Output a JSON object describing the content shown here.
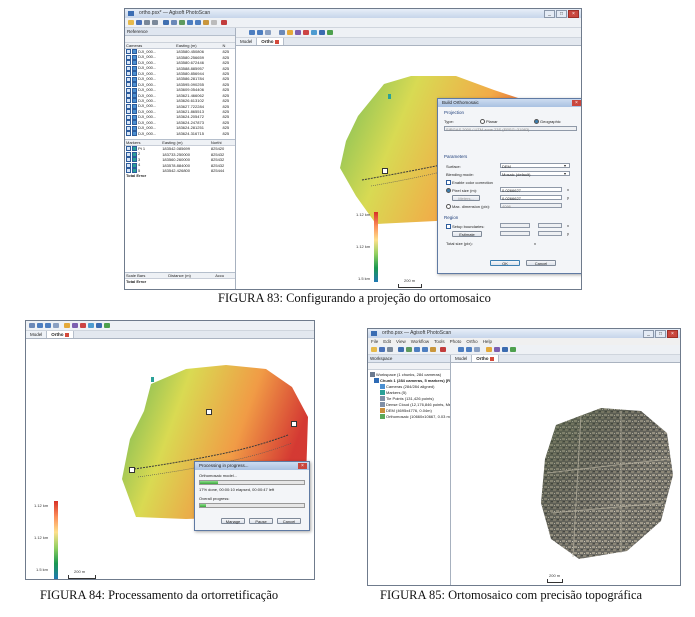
{
  "captions": {
    "fig83": "FIGURA 83: Configurando a projeção do ortomosaico",
    "fig84": "FIGURA 84: Processamento da ortorretificação",
    "fig85": "FIGURA 85: Ortomosaico com precisão topográfica"
  },
  "fig83": {
    "window_title": "ortho.psx* — Agisoft PhotoScan",
    "reference_panel_title": "Reference",
    "cameras_headers": [
      "Cameras",
      "Easting (m)",
      "N"
    ],
    "cameras": [
      {
        "name": "DJI_000...",
        "easting": "183580.450806",
        "n": "825"
      },
      {
        "name": "DJI_000...",
        "easting": "183580.256659",
        "n": "825"
      },
      {
        "name": "DJI_000...",
        "easting": "183580.672446",
        "n": "825"
      },
      {
        "name": "DJI_000...",
        "easting": "183588.885957",
        "n": "825"
      },
      {
        "name": "DJI_000...",
        "easting": "183580.856944",
        "n": "825"
      },
      {
        "name": "DJI_000...",
        "easting": "183586.281784",
        "n": "825"
      },
      {
        "name": "DJI_000...",
        "easting": "183595.090255",
        "n": "825"
      },
      {
        "name": "DJI_000...",
        "easting": "183609.054406",
        "n": "825"
      },
      {
        "name": "DJI_000...",
        "easting": "183621.466062",
        "n": "825"
      },
      {
        "name": "DJI_000...",
        "easting": "183626.613102",
        "n": "825"
      },
      {
        "name": "DJI_000...",
        "easting": "183627.722284",
        "n": "825"
      },
      {
        "name": "DJI_000...",
        "easting": "183621.865513",
        "n": "825"
      },
      {
        "name": "DJI_000...",
        "easting": "183624.205472",
        "n": "825"
      },
      {
        "name": "DJI_000...",
        "easting": "183624.247873",
        "n": "825"
      },
      {
        "name": "DJI_000...",
        "easting": "183624.281251",
        "n": "825"
      },
      {
        "name": "DJI_000...",
        "easting": "183624.316715",
        "n": "825"
      }
    ],
    "markers_headers": [
      "Markers",
      "Easting (m)",
      "Northi"
    ],
    "markers": [
      {
        "name": "Pt 1",
        "easting": "183542.085699",
        "n": "825420"
      },
      {
        "name": "2",
        "easting": "183733.250000",
        "n": "825432"
      },
      {
        "name": "3",
        "easting": "183560.260000",
        "n": "825432"
      },
      {
        "name": "4",
        "easting": "183578.884000",
        "n": "825432"
      },
      {
        "name": "5",
        "easting": "183542.426800",
        "n": "825444"
      }
    ],
    "total_error": "Total Error",
    "scale_headers": [
      "Scale Bars",
      "Distance (m)",
      "Accu"
    ],
    "scale_total_error": "Total Error",
    "tabs": [
      "Model",
      "Ortho"
    ],
    "colorbar_top": "1.12 km",
    "colorbar_mid": "1.12 km",
    "colorbar_bottom": "1.5 km",
    "scale_label": "200 m",
    "dialog": {
      "title": "Build Orthomosaic",
      "projection_label": "Projection",
      "type_label": "Type:",
      "type_planar": "Planar",
      "type_geographic": "Geographic",
      "crs_value": "SIRGAS 2000 / UTM zone 23S (EPSG::31983)",
      "parameters_label": "Parameters",
      "surface_label": "Surface:",
      "surface_value": "DEM",
      "blending_label": "Blending mode:",
      "blending_value": "Mosaic (default)",
      "enable_color_correction": "Enable color correction",
      "pixel_size_label": "Pixel size (m):",
      "pixel_size_x": "0.0266627",
      "pixel_size_y": "0.0266627",
      "meters_btn": "Meters...",
      "max_dim_label": "Max. dimension (pix):",
      "max_dim_value": "4096",
      "region_label": "Region",
      "setup_boundaries": "Setup boundaries:",
      "estimate_btn": "Estimate",
      "total_size_label": "Total size (pix):",
      "x_mark": "x",
      "y_mark": "y",
      "ok_btn": "OK",
      "cancel_btn": "Cancel"
    }
  },
  "fig84": {
    "tabs": [
      "Model",
      "Ortho"
    ],
    "colorbar_top": "1.12 km",
    "colorbar_mid": "1.12 km",
    "colorbar_bottom": "1.5 km",
    "scale_label": "200 m",
    "dialog": {
      "title": "Processing in progress...",
      "task": "Orthomosaic model...",
      "current_status": "17% done, 00:00:10 elapsed, 00:00:47 left",
      "current_progress": 0.17,
      "overall_label": "Overall progress:",
      "overall_progress": 0.06,
      "pause_btn": "Pause",
      "cancel_btn": "Cancel",
      "manage_btn": "Manage"
    }
  },
  "fig85": {
    "window_title": "ortho.psx — Agisoft PhotoScan",
    "menu": [
      "File",
      "Edit",
      "View",
      "Workflow",
      "Tools",
      "Photo",
      "Ortho",
      "Help"
    ],
    "workspace_title": "Workspace",
    "tabs": [
      "Model",
      "Ortho"
    ],
    "tree": [
      "Workspace (1 chunks, 284 cameras)",
      "Chunk 1 (284 cameras, 5 markers) [R]",
      "Cameras (284/284 aligned)",
      "Markers (5)",
      "Tie Points (131,426 points)",
      "Dense Cloud (12,176,846 points, Me)",
      "DEM (4695x4776, 0.04m)",
      "Orthomosaic (10660x10667, 0.03 m)"
    ],
    "scale_label": "200 m"
  }
}
